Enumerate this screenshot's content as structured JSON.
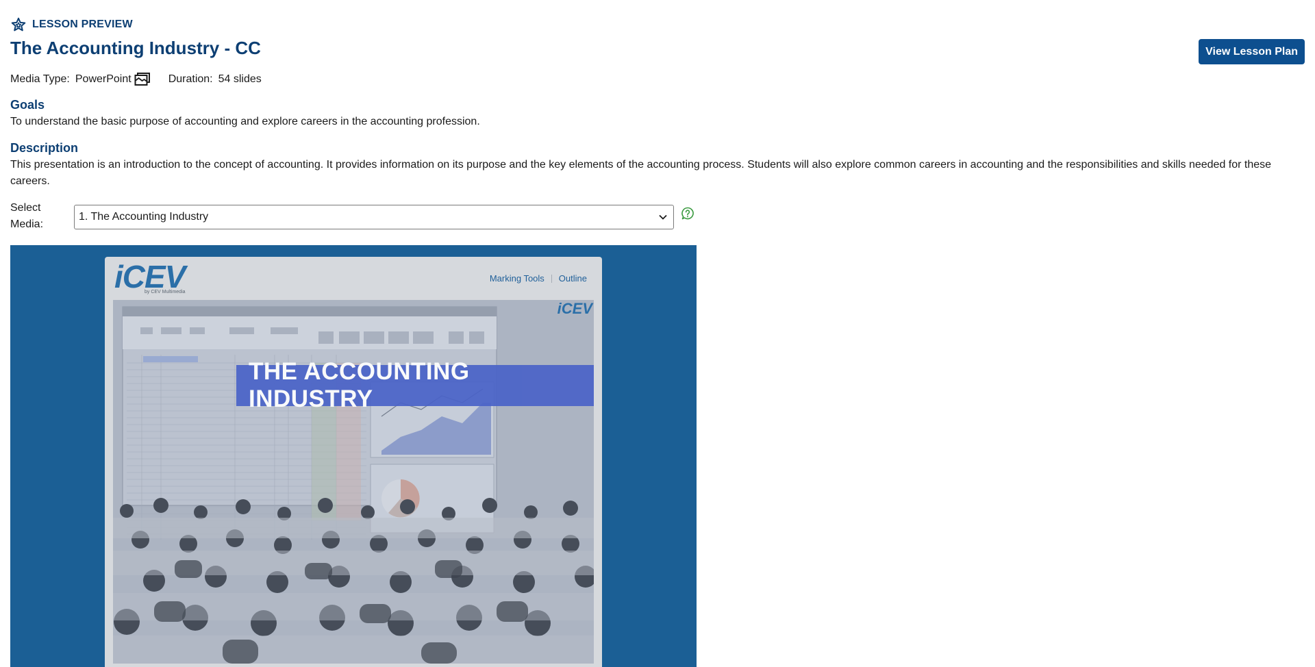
{
  "header": {
    "eyebrow": "LESSON PREVIEW",
    "title": "The Accounting Industry - CC",
    "view_button": "View Lesson Plan"
  },
  "meta": {
    "media_type_label": "Media Type:",
    "media_type_value": "PowerPoint",
    "duration_label": "Duration:",
    "duration_value": "54 slides"
  },
  "goals": {
    "heading": "Goals",
    "text": "To understand the basic purpose of accounting and explore careers in the accounting profession."
  },
  "description": {
    "heading": "Description",
    "text": "This presentation is an introduction to the concept of accounting. It provides information on its purpose and the key elements of the accounting process. Students will also explore common careers in accounting and the responsibilities and skills needed for these careers."
  },
  "media_select": {
    "label": "Select Media:",
    "selected": "1. The Accounting Industry"
  },
  "viewer": {
    "logo_mark": "iCEV",
    "logo_sub": "by CEV Multimedia",
    "marking_tools": "Marking Tools",
    "outline": "Outline",
    "corner_logo": "iCEV",
    "slide_title": "THE ACCOUNTING INDUSTRY"
  },
  "colors": {
    "brand_navy": "#0d3f73",
    "button_blue": "#0d4f8f",
    "viewer_blue": "#1b5f95",
    "help_green": "#3a9a3f",
    "banner_blue": "#4a63c8"
  },
  "icons": {
    "eyebrow": "star-outline-icon",
    "media_type": "slides-stack-icon",
    "dropdown": "chevron-down-icon",
    "help": "help-circle-icon"
  }
}
